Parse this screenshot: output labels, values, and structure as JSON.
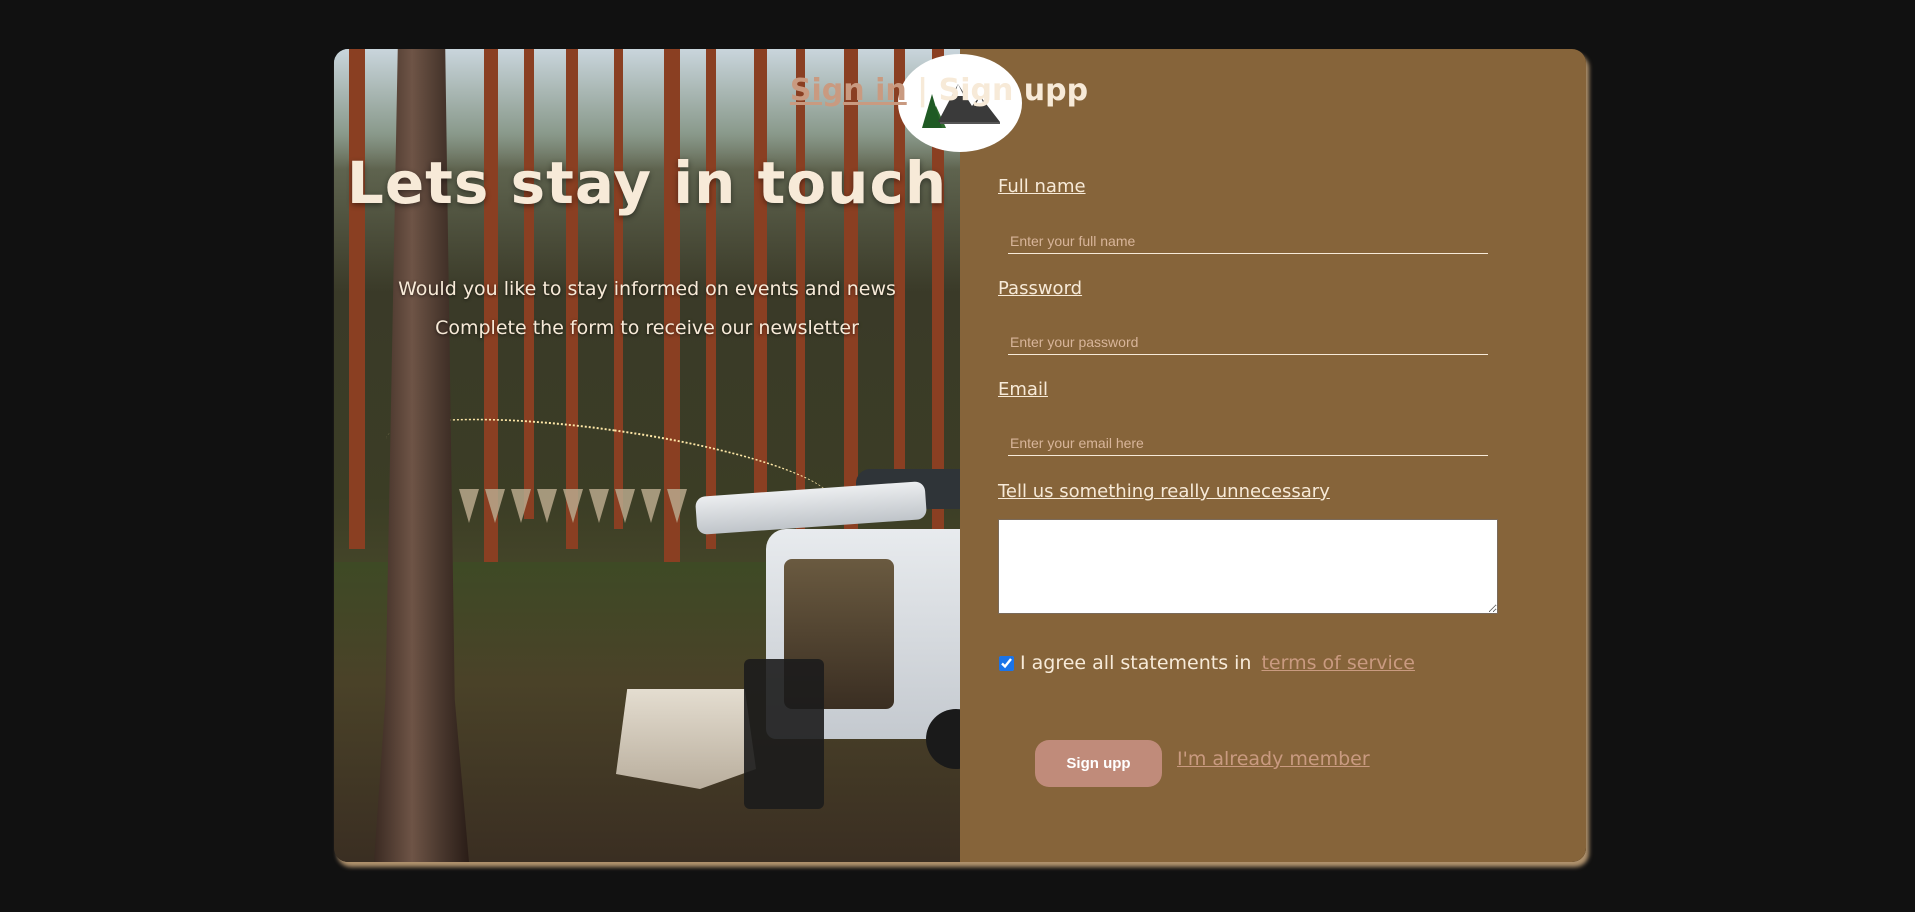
{
  "hero": {
    "headline": "Lets stay in touch",
    "subline_1": "Would you like to stay informed on events and news",
    "subline_2": "Complete the form to receive our newsletter",
    "image": "camping-van-forest-photo"
  },
  "logo": {
    "icon": "mountain-forest-logo-icon"
  },
  "form_switch": {
    "sign_in": "Sign in",
    "separator": "|",
    "sign_up": "Sign upp"
  },
  "form": {
    "full_name_label": "Full name",
    "full_name_placeholder": "Enter your full name",
    "password_label": "Password",
    "password_placeholder": "Enter your password",
    "email_label": "Email",
    "email_placeholder": "Enter your email here",
    "unnecessary_label": "Tell us something really unnecessary",
    "unnecessary_value": "",
    "agree_text": "I agree all statements in",
    "terms_link": "terms of service",
    "agree_checked": true,
    "submit_label": "Sign upp",
    "member_link": "I'm already member"
  },
  "colors": {
    "page_bg": "#111111",
    "panel_bg": "#86643a",
    "text_cream": "#f7ead8",
    "accent": "#c99a80",
    "button": "#c08b7a"
  }
}
